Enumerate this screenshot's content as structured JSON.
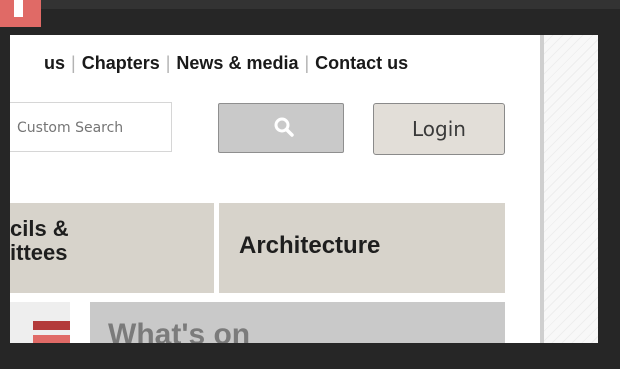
{
  "topnav": {
    "items": [
      "us",
      "Chapters",
      "News & media",
      "Contact us"
    ],
    "separator": "|"
  },
  "search": {
    "placeholder": "Custom Search",
    "button_icon": "search-icon"
  },
  "login": {
    "label": "Login"
  },
  "tiles": {
    "councils_line1": "cils &",
    "councils_line2": "ittees",
    "architecture": "Architecture",
    "whats_on": "What's on"
  },
  "colors": {
    "accent_red": "#e06a66",
    "dark_red": "#b33a3a",
    "tile_beige": "#d7d3cb",
    "button_gray": "#c9c9c9"
  }
}
